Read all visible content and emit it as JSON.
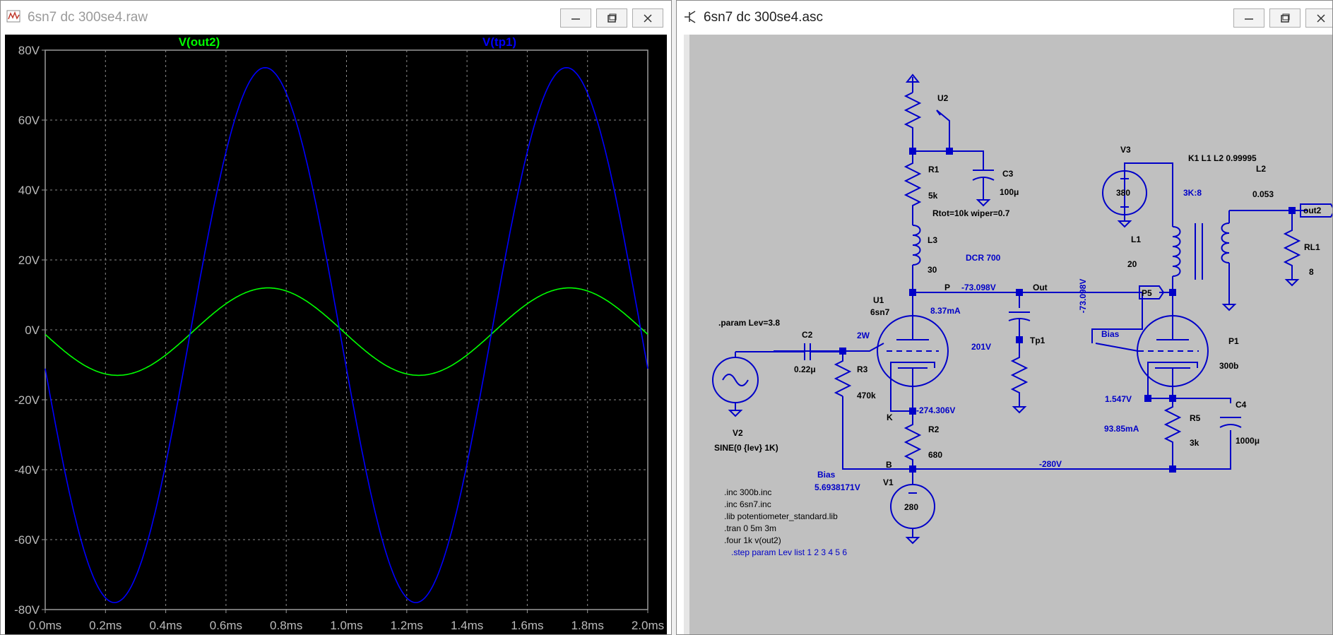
{
  "plot_window": {
    "title": "6sn7 dc 300se4.raw",
    "controls": {
      "minimize": "minimize",
      "maximize": "maximize",
      "close": "close"
    }
  },
  "schematic_window": {
    "title": "6sn7 dc 300se4.asc"
  },
  "chart_data": {
    "type": "line",
    "x_unit": "ms",
    "xlim": [
      0.0,
      2.0
    ],
    "ylim": [
      -80,
      80
    ],
    "x_ticks": [
      "0.0ms",
      "0.2ms",
      "0.4ms",
      "0.6ms",
      "0.8ms",
      "1.0ms",
      "1.2ms",
      "1.4ms",
      "1.6ms",
      "1.8ms",
      "2.0ms"
    ],
    "y_ticks": [
      "80V",
      "60V",
      "40V",
      "20V",
      "0V",
      "-20V",
      "-40V",
      "-60V",
      "-80V"
    ],
    "grid": true,
    "legend_position": "top",
    "series": [
      {
        "name": "V(out2)",
        "color": "#00ff00",
        "amplitude": 12.5,
        "offset": -0.5,
        "period_ms": 1.0,
        "phase_peak_ms": 0.74,
        "x": [
          0.0,
          0.24,
          0.49,
          0.74,
          0.99,
          1.24,
          1.49,
          1.74,
          2.0
        ],
        "y": [
          -0.5,
          -11.5,
          -0.5,
          12.5,
          -0.5,
          -11.5,
          -0.5,
          12.5,
          -0.5
        ]
      },
      {
        "name": "V(tp1)",
        "color": "#0000ff",
        "amplitude": 76.5,
        "offset": -1.5,
        "period_ms": 1.0,
        "phase_peak_ms": 0.73,
        "x": [
          0.0,
          0.23,
          0.48,
          0.73,
          0.98,
          1.23,
          1.48,
          1.73,
          2.0
        ],
        "y": [
          -5,
          -78,
          -1.5,
          75,
          -1.5,
          -78,
          -1.5,
          75,
          -5
        ]
      }
    ]
  },
  "schematic": {
    "labels": {
      "u2": "U2",
      "r1": "R1",
      "r1_val": "5k",
      "c3": "C3",
      "c3_val": "100μ",
      "rtot": "Rtot=10k wiper=0.7",
      "l3": "L3",
      "l3_val": "30",
      "dcr": "DCR 700",
      "p": "P",
      "v_plate": "-73.098V",
      "out": "Out",
      "u1": "U1",
      "u1_val": "6sn7",
      "i_plate": "8.37mA",
      "param": ".param Lev=3.8",
      "c2": "C2",
      "c2_val": "0.22μ",
      "p_2w": "2W",
      "v201": "201V",
      "tp1": "Tp1",
      "r3": "R3",
      "r3_val": "470k",
      "k": "K",
      "v_k": "-274.306V",
      "r2": "R2",
      "r2_val": "680",
      "b": "B",
      "v2": "V2",
      "v2_val": "SINE(0 {lev} 1K)",
      "bias": "Bias",
      "bias_v": "5.6938171V",
      "v1": "V1",
      "v1_val": "280",
      "neg280": "-280V",
      "v3": "V3",
      "v3_val": "380",
      "k1": "K1 L1 L2 0.99995",
      "l2": "L2",
      "l2_val": "0.053",
      "ratio": "3K:8",
      "l1": "L1",
      "l1_val": "20",
      "out2": "out2",
      "rl1": "RL1",
      "rl1_val": "8",
      "p5": "P5",
      "v_vert": "-73.098V",
      "bias2": "Bias",
      "p1": "P1",
      "p1_val": "300b",
      "v1547": "1.547V",
      "i_p1": "93.85mA",
      "r5": "R5",
      "r5_val": "3k",
      "c4": "C4",
      "c4_val": "1000μ"
    },
    "directives": [
      ".inc 300b.inc",
      ".inc 6sn7.inc",
      ".lib potentiometer_standard.lib",
      ".tran 0 5m 3m",
      ".four 1k v(out2)"
    ],
    "step": ".step param Lev list 1 2 3 4 5 6"
  }
}
